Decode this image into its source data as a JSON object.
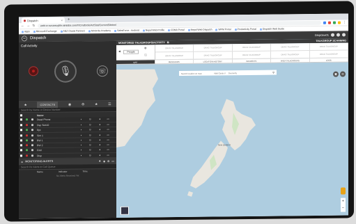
{
  "browser": {
    "tab_title": "Dispatch",
    "url": "web-cr-nzcarscyble.simlabs.com/#/Cmdtools/ActStat/CurrentSitetool",
    "bookmarks": [
      "Apps",
      "Microsoft Exchange",
      "ANZ Oracle Partners",
      "Motorola Academy",
      "SalesForce - Android",
      "Nepal Web Profile",
      "CDMA Portal",
      "Nepal Web Dispatch",
      "WPM Portal",
      "Productivity Portal",
      "Dispatch Web Guide"
    ]
  },
  "app": {
    "title": "Dispatch",
    "user": "DispOne01"
  },
  "call_activity": {
    "label": "Call Activity"
  },
  "contacts": {
    "tab_label": "CONTACTS",
    "search_placeholder": "Search by Name or Device Number",
    "column_name": "Name",
    "rows": [
      {
        "name": "Dead Phone"
      },
      {
        "name": "Dsp Sub10"
      },
      {
        "name": "Rpt"
      },
      {
        "name": "Sim 1"
      },
      {
        "name": "BW 1"
      },
      {
        "name": "BW 2"
      },
      {
        "name": "Grid"
      },
      {
        "name": "Disp"
      }
    ]
  },
  "alerts": {
    "title": "MONITORING ALERTS",
    "search_placeholder": "Search for Alerts to Call Queue",
    "columns": [
      "Name",
      "Indicator",
      "Time"
    ],
    "empty_text": "No Alerts Received Yet"
  },
  "talkgroups": {
    "header": "MONITORED TALKGROUPS/ACTIVITY",
    "scanning": "TALKGROUP SCANNING",
    "selector_label": "People",
    "cells": [
      "DRAG TALKGROUP",
      "DRAG TALKGROUP",
      "DRAG TALKGROUP",
      "DRAG TALKGROUP",
      "DRAG TALKGROUP",
      "DRAG TALKGROUP",
      "DRAG TALKGROUP",
      "DRAG TALKGROUP",
      "DRAG TALKGROUP",
      "DRAG TALKGROUP"
    ]
  },
  "map_tabs": [
    "MAP",
    "MESSAGES",
    "LOCATION HISTORY",
    "INCIDENTS",
    "AREA TALKGROUPS",
    "LOGS"
  ],
  "map": {
    "search_placeholder": "Search location on map",
    "filter_label": "Wild Cards V",
    "layer_label": "Geometry",
    "place_label": "New Zealand"
  }
}
